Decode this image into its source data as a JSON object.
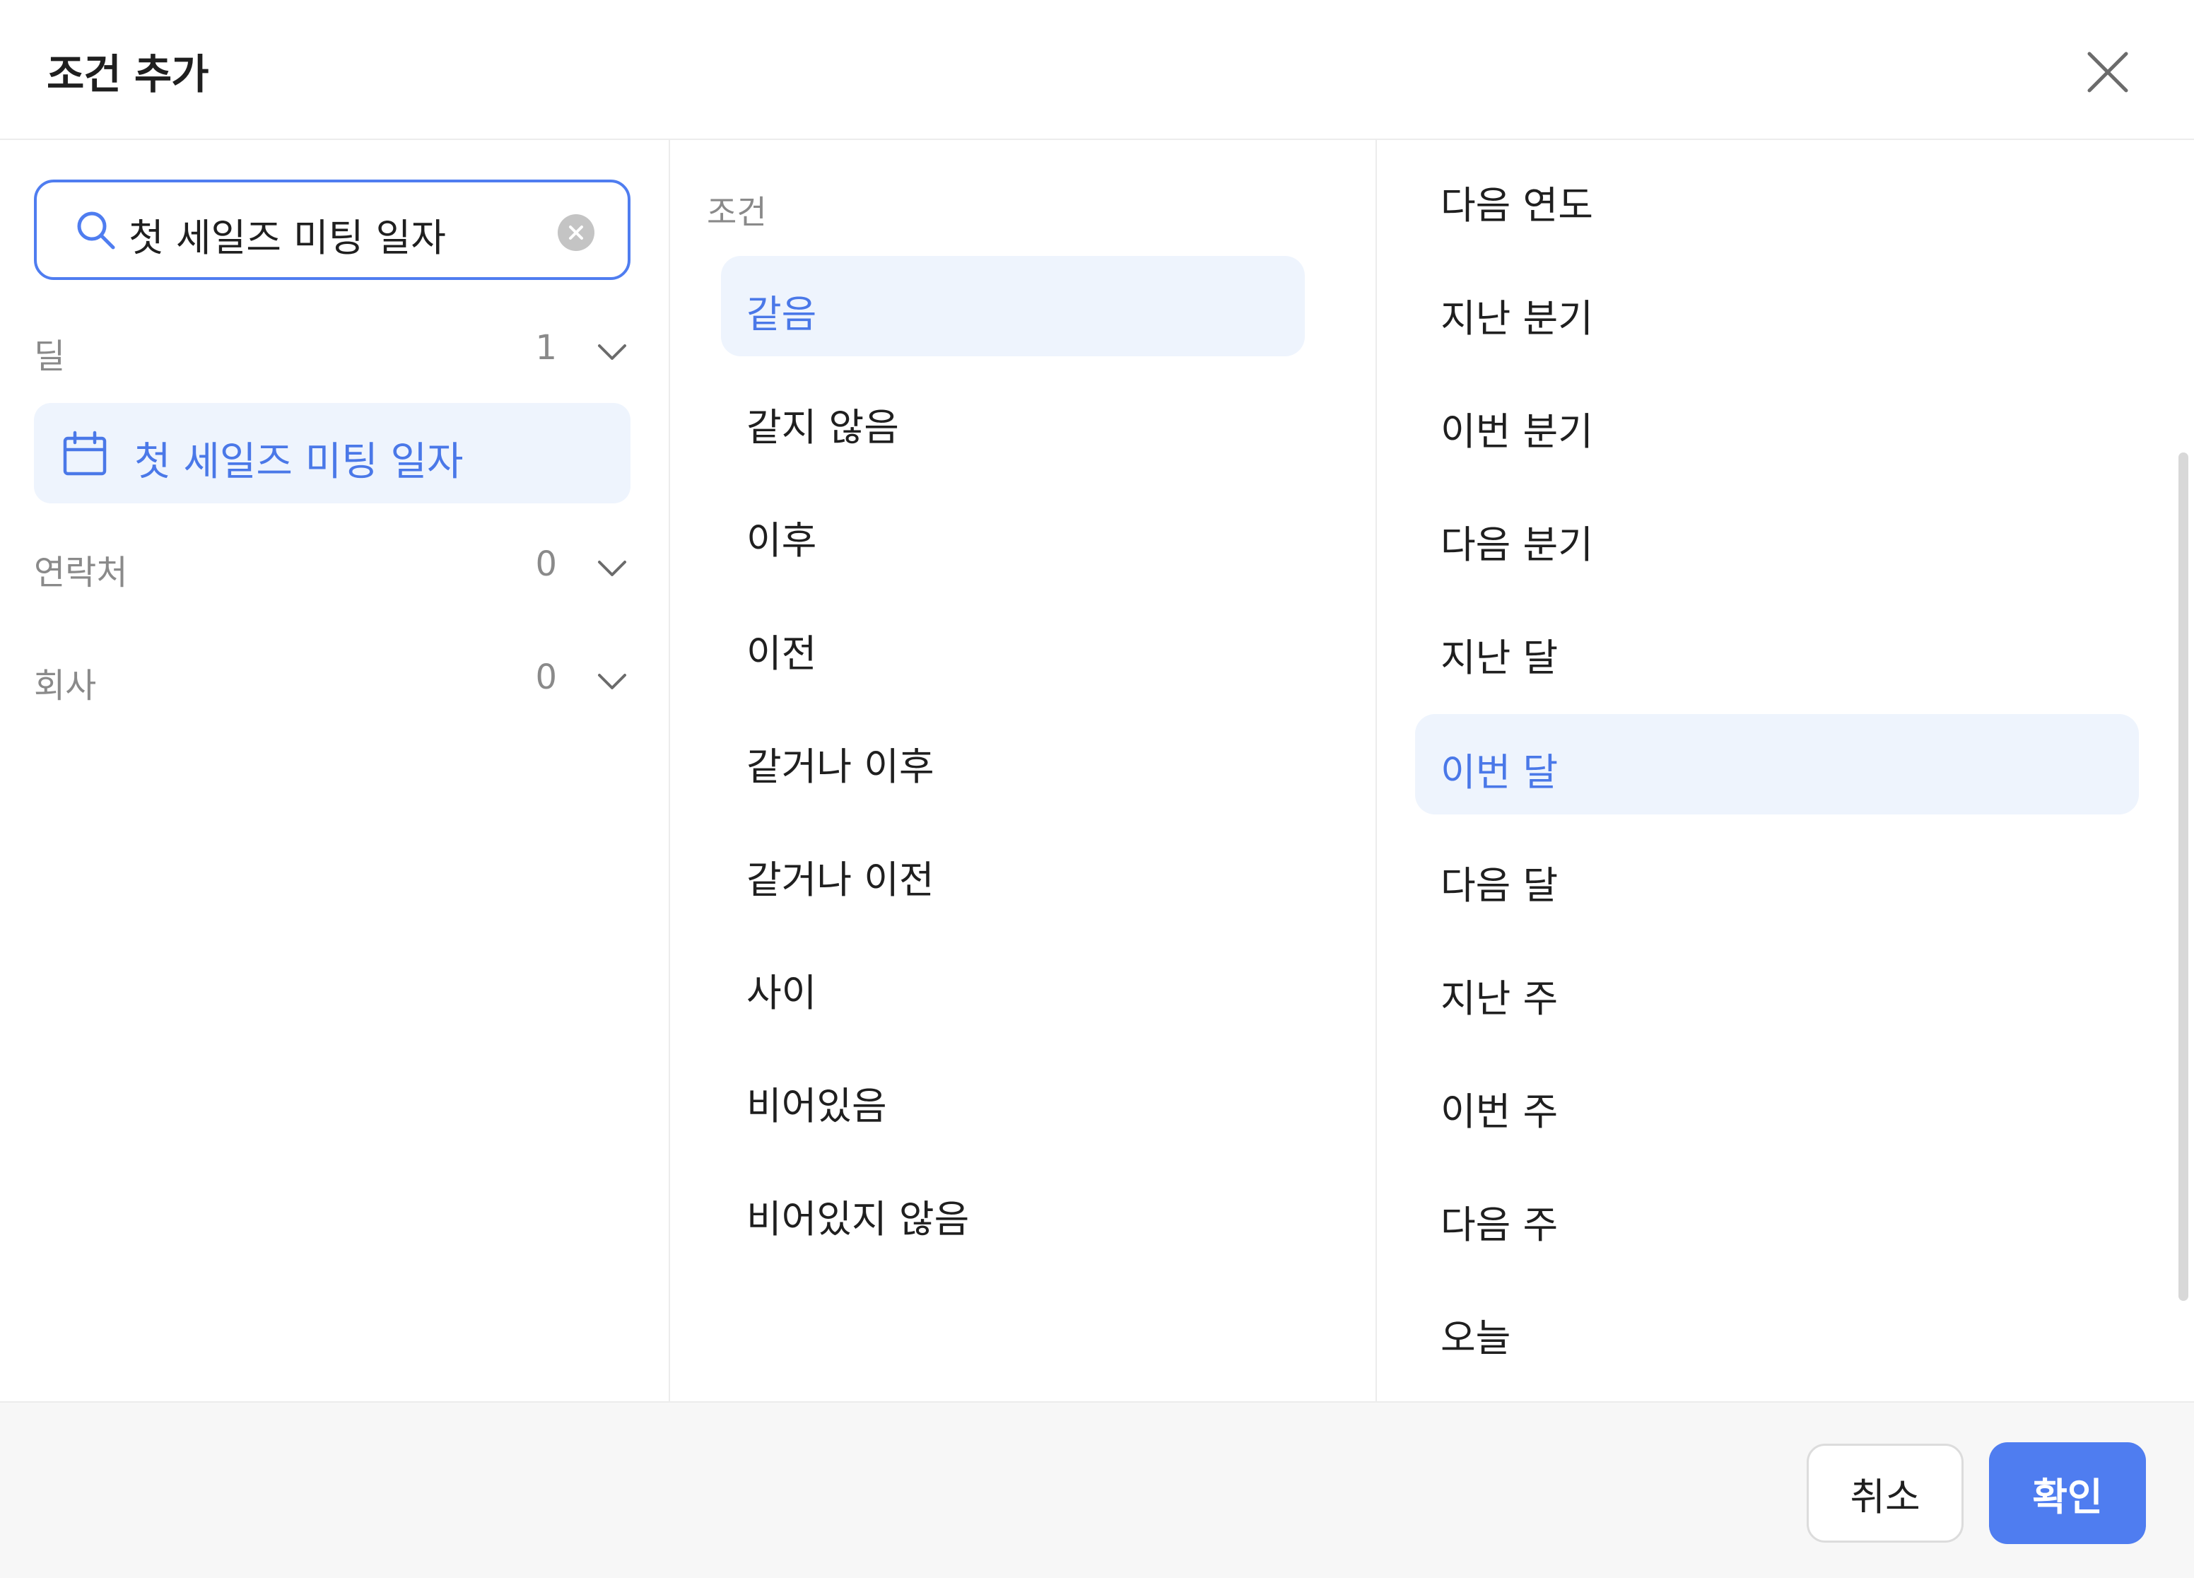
{
  "dialog": {
    "title": "조건 추가"
  },
  "search": {
    "value": "첫 세일즈 미팅 일자"
  },
  "groups": [
    {
      "label": "딜",
      "count": "1"
    },
    {
      "label": "연락처",
      "count": "0"
    },
    {
      "label": "회사",
      "count": "0"
    }
  ],
  "field": {
    "label": "첫 세일즈 미팅 일자"
  },
  "conditions": {
    "header": "조건",
    "selected": "같음",
    "items": [
      "같음",
      "같지 않음",
      "이후",
      "이전",
      "같거나 이후",
      "같거나 이전",
      "사이",
      "비어있음",
      "비어있지 않음"
    ]
  },
  "periods": {
    "selected": "이번 달",
    "items": [
      "다음 연도",
      "지난 분기",
      "이번 분기",
      "다음 분기",
      "지난 달",
      "이번 달",
      "다음 달",
      "지난 주",
      "이번 주",
      "다음 주",
      "오늘"
    ]
  },
  "footer": {
    "cancel_label": "취소",
    "confirm_label": "확인"
  },
  "colors": {
    "accent": "#4f7df0",
    "selected_bg": "#eef4fd",
    "selected_text": "#4a78e8"
  }
}
